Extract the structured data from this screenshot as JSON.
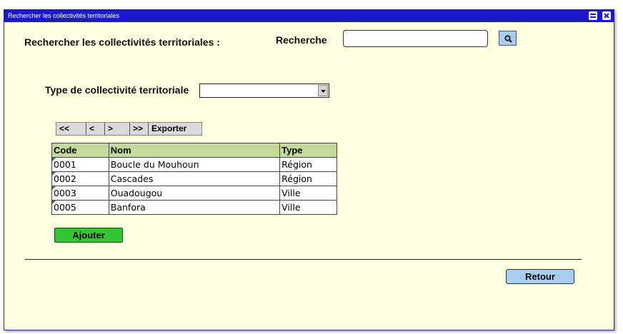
{
  "window": {
    "title": "Rechercher les collectivités territoriales"
  },
  "form": {
    "heading": "Rechercher les collectivités territoriales :",
    "search_label": "Recherche",
    "search_value": "",
    "type_label": "Type de collectivité territoriale",
    "type_selected": ""
  },
  "icons": {
    "search": "search-icon",
    "restore": "window-restore-icon",
    "close": "window-close-icon",
    "dropdown": "chevron-down-icon"
  },
  "pager": {
    "first": "<<",
    "prev": "<",
    "next": ">",
    "last": ">>",
    "export": "Exporter"
  },
  "table": {
    "columns": [
      "Code",
      "Nom",
      "Type"
    ],
    "rows": [
      {
        "code": "0001",
        "nom": "Boucle du Mouhoun",
        "type": "Région"
      },
      {
        "code": "0002",
        "nom": "Cascades",
        "type": "Région"
      },
      {
        "code": "0003",
        "nom": "Ouadougou",
        "type": "Ville"
      },
      {
        "code": "0005",
        "nom": "Banfora",
        "type": "Ville"
      }
    ]
  },
  "actions": {
    "add": "Ajouter",
    "back": "Retour"
  },
  "colors": {
    "titlebar": "#1a1acc",
    "background": "#fefee0",
    "header": "#c5d99b",
    "add_button": "#33c533",
    "blue_button": "#a8cdee"
  }
}
